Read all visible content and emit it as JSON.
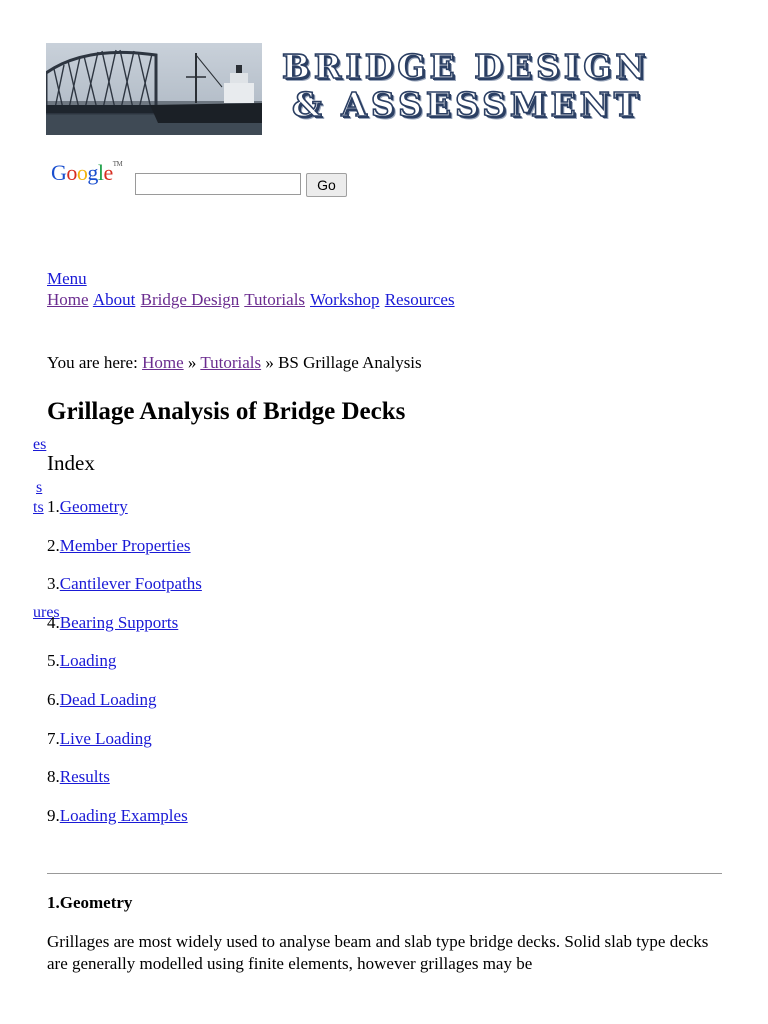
{
  "banner": {
    "title_line1": "BRIDGE DESIGN",
    "title_line2": "& ASSESSMENT"
  },
  "search": {
    "logo_text": "Google",
    "logo_tm": "TM",
    "input_value": "",
    "go_label": "Go"
  },
  "nav": {
    "menu_label": "Menu",
    "items": [
      {
        "label": "Home"
      },
      {
        "label": "About"
      },
      {
        "label": "Bridge Design"
      },
      {
        "label": "Tutorials"
      },
      {
        "label": "Workshop"
      },
      {
        "label": "Resources"
      }
    ]
  },
  "breadcrumb": {
    "prefix": "You are here:",
    "home": "Home",
    "separator": "»",
    "tutorials": "Tutorials",
    "current": "BS Grillage Analysis"
  },
  "page_title": "Grillage Analysis of Bridge Decks",
  "clipped_sidebar": [
    "es",
    "s",
    "ts",
    "ures"
  ],
  "index": {
    "heading": "Index",
    "items": [
      {
        "num": "1.",
        "label": "Geometry"
      },
      {
        "num": "2.",
        "label": "Member Properties"
      },
      {
        "num": "3.",
        "label": "Cantilever Footpaths"
      },
      {
        "num": "4.",
        "label": "Bearing Supports"
      },
      {
        "num": "5.",
        "label": "Loading"
      },
      {
        "num": "6.",
        "label": "Dead Loading"
      },
      {
        "num": "7.",
        "label": "Live Loading"
      },
      {
        "num": "8.",
        "label": "Results"
      },
      {
        "num": "9.",
        "label": "Loading Examples"
      }
    ]
  },
  "section": {
    "heading": "1.Geometry",
    "paragraph": "Grillages are most widely used to analyse beam and slab type bridge decks. Solid slab type decks are generally modelled using finite elements, however grillages may be"
  },
  "colors": {
    "link": "#1a1ad6",
    "visited_link": "#6b2c8f",
    "banner_ink": "#2b3f63"
  }
}
